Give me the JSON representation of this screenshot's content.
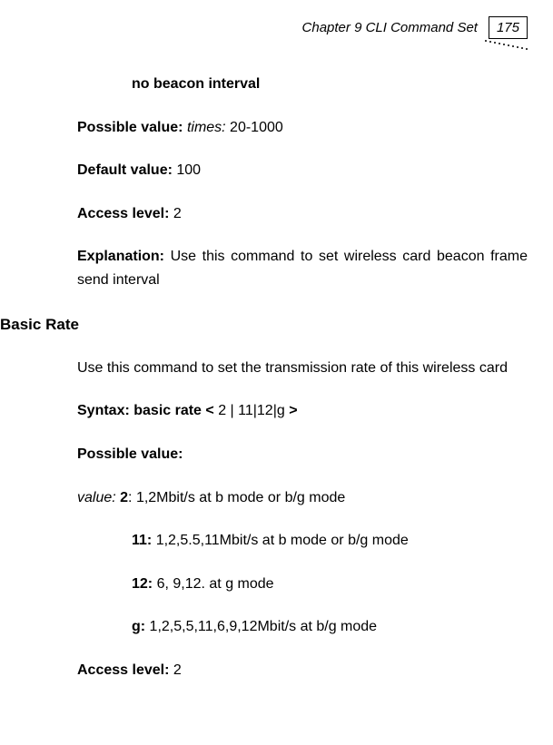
{
  "header": {
    "chapter_title": "Chapter 9 CLI Command Set",
    "page_number": "175"
  },
  "content": {
    "no_beacon_interval": "no beacon interval",
    "possible_value_label": "Possible value: ",
    "possible_value_param": "times:",
    "possible_value_range": " 20-1000",
    "default_value_label": "Default value: ",
    "default_value_val": "100",
    "access_level_label": "Access level: ",
    "access_level_val_1": "2",
    "explanation_label": "Explanation: ",
    "explanation_text": "Use this command to set wireless card beacon frame send interval",
    "basic_rate_title": "Basic Rate",
    "basic_rate_desc": "Use this command to set the transmission rate of this wireless card",
    "syntax_label": "Syntax: basic rate < ",
    "syntax_vals": "2 | 11|12|g",
    "syntax_close": " >",
    "possible_value_2": "Possible value:",
    "value_param": "value:",
    "value_2_label": " 2",
    "value_2_text": ": 1,2Mbit/s at  b mode or b/g mode",
    "value_11_label": "11: ",
    "value_11_text": "1,2,5.5,11Mbit/s at b mode or b/g mode",
    "value_12_label": "12:  ",
    "value_12_text": "6, 9,12. at g mode",
    "value_g_label": " g: ",
    "value_g_text": "1,2,5,5,11,6,9,12Mbit/s at b/g mode",
    "access_level_label_2": "Access level: ",
    "access_level_val_2": "2"
  }
}
